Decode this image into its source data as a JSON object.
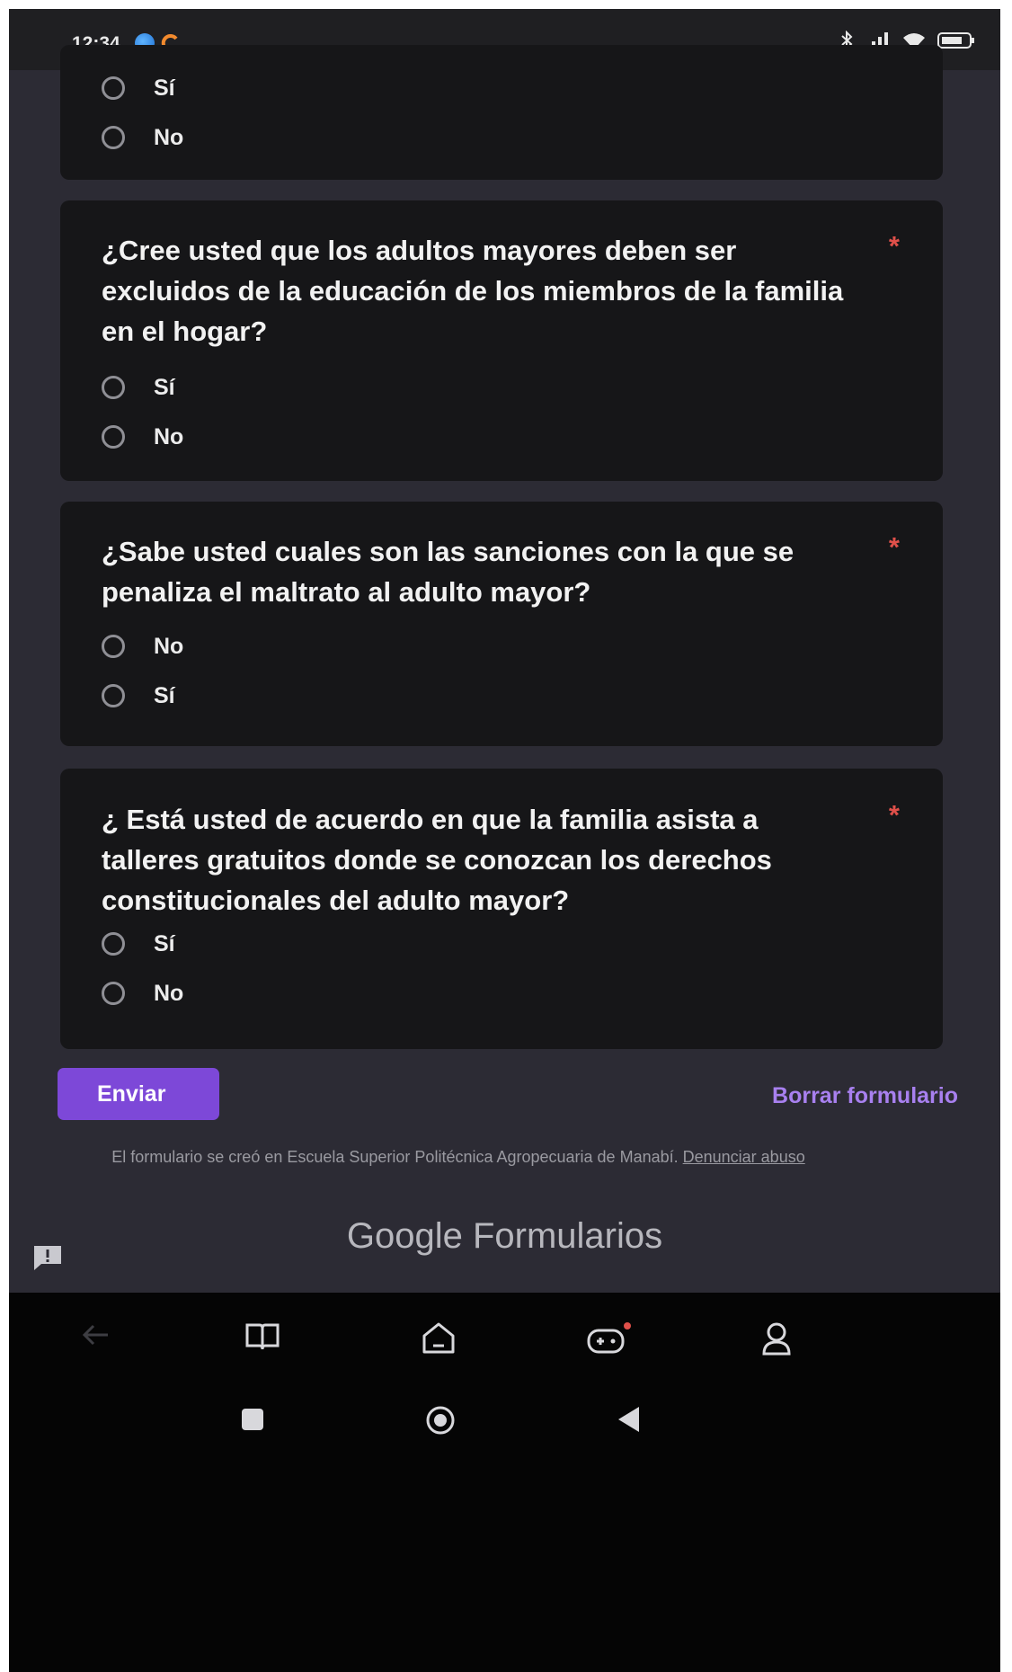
{
  "status_bar": {
    "time": "12:34"
  },
  "questions": [
    {
      "title": "",
      "required_mark": "",
      "options": [
        "Sí",
        "No"
      ]
    },
    {
      "title": "¿Cree usted que los adultos mayores deben ser excluidos de la educación de los miembros de la familia en el hogar?",
      "required_mark": "*",
      "options": [
        "Sí",
        "No"
      ]
    },
    {
      "title": "¿Sabe usted cuales son las sanciones con la que se penaliza el maltrato al adulto mayor?",
      "required_mark": "*",
      "options": [
        "No",
        "Sí"
      ]
    },
    {
      "title": "¿ Está usted de acuerdo en que la familia asista a talleres gratuitos donde se conozcan los derechos constitucionales del adulto mayor?",
      "required_mark": "*",
      "options": [
        "Sí",
        "No"
      ]
    }
  ],
  "actions": {
    "submit_label": "Enviar",
    "clear_label": "Borrar formulario"
  },
  "footer": {
    "created_text": "El formulario se creó en Escuela Superior Politécnica Agropecuaria de Manabí.",
    "report_link": "Denunciar abuso",
    "brand": "Google Formularios"
  },
  "colors": {
    "background": "#2c2b34",
    "card": "#161618",
    "accent": "#7d48d8",
    "accent_text": "#a880ef",
    "required": "#e0504a"
  },
  "icons": {
    "app_nav": [
      "back-arrow-icon",
      "book-icon",
      "home-icon",
      "gamepad-icon",
      "profile-icon"
    ],
    "system_nav": [
      "recents-square-icon",
      "home-circle-icon",
      "back-triangle-icon"
    ]
  }
}
